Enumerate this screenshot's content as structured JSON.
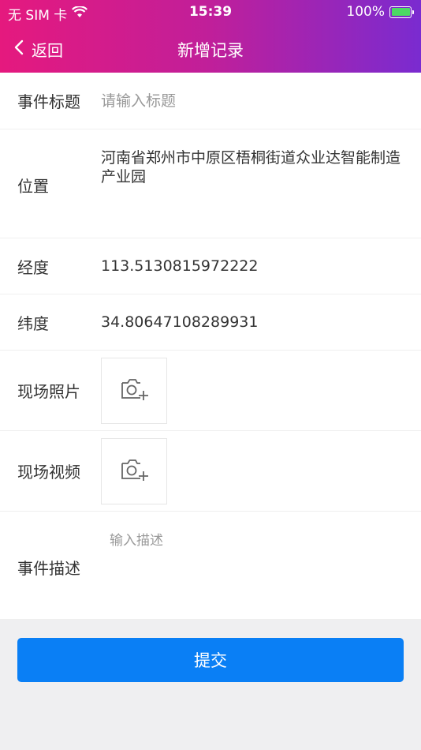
{
  "status_bar": {
    "carrier": "无 SIM 卡",
    "time": "15:39",
    "battery": "100%"
  },
  "nav": {
    "back_label": "返回",
    "title": "新增记录"
  },
  "form": {
    "title": {
      "label": "事件标题",
      "placeholder": "请输入标题",
      "value": ""
    },
    "location": {
      "label": "位置",
      "value": "河南省郑州市中原区梧桐街道众业达智能制造产业园"
    },
    "longitude": {
      "label": "经度",
      "value": "113.5130815972222"
    },
    "latitude": {
      "label": "纬度",
      "value": "34.80647108289931"
    },
    "photo": {
      "label": "现场照片"
    },
    "video": {
      "label": "现场视频"
    },
    "description": {
      "label": "事件描述",
      "placeholder": "输入描述",
      "value": ""
    }
  },
  "submit_label": "提交",
  "colors": {
    "header_gradient_start": "#e5197e",
    "header_gradient_end": "#7a2bd0",
    "primary_button": "#0a7ff5",
    "battery_green": "#4cd964"
  }
}
